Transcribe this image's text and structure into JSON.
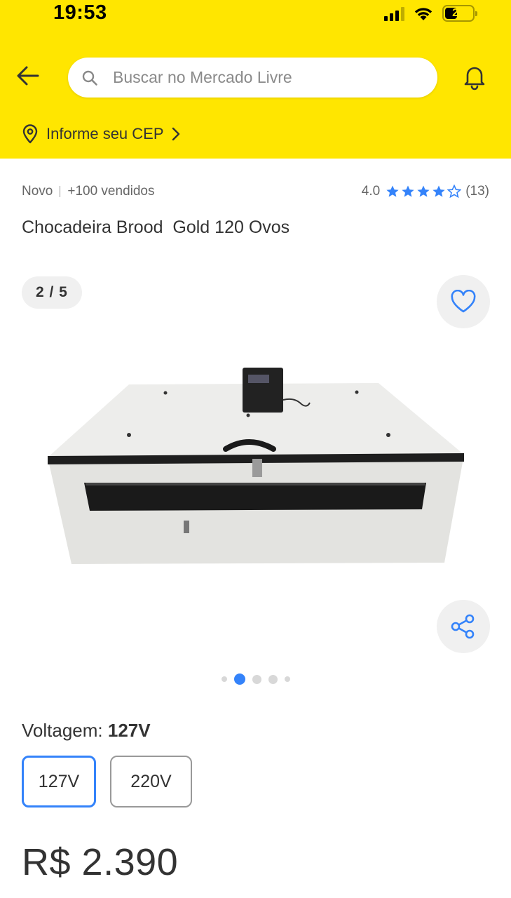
{
  "status_bar": {
    "time": "19:53",
    "battery_level": "25",
    "signal_bars_active": 3,
    "icons": [
      "signal-icon",
      "wifi-icon",
      "battery-icon"
    ]
  },
  "header": {
    "back_icon": "arrow-left-icon",
    "search_placeholder": "Buscar no Mercado Livre",
    "search_icon": "search-icon",
    "bell_icon": "bell-icon",
    "cep_label": "Informe seu CEP",
    "cep_icon": "location-pin-icon",
    "cep_chevron": "chevron-right-icon"
  },
  "product": {
    "condition": "Novo",
    "sold": "+100 vendidos",
    "rating_value": "4.0",
    "rating_stars": 4,
    "rating_max": 5,
    "rating_count": "(13)",
    "title": "Chocadeira Brood  Gold 120 Ovos"
  },
  "gallery": {
    "counter": "2 / 5",
    "current_index": 2,
    "total": 5,
    "favorite_icon": "heart-icon",
    "share_icon": "share-icon",
    "image_icon": "product-image-incubator"
  },
  "variant": {
    "label": "Voltagem:",
    "selected_value": "127V",
    "options": [
      {
        "label": "127V",
        "selected": true
      },
      {
        "label": "220V",
        "selected": false
      }
    ]
  },
  "price": {
    "text": "R$ 2.390"
  },
  "colors": {
    "header_bg": "#FFE600",
    "accent_blue": "#3483FA",
    "text_primary": "#333333",
    "text_secondary": "#666666"
  }
}
